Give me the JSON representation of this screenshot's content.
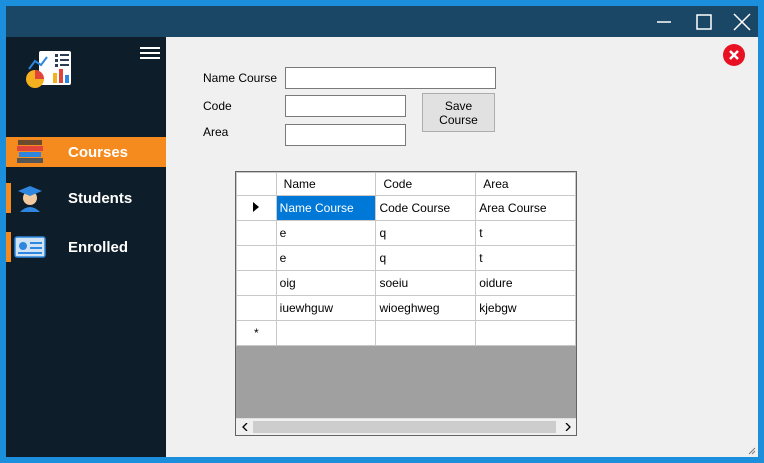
{
  "window": {
    "controls": [
      "minimize-icon",
      "maximize-icon",
      "close-icon"
    ]
  },
  "sidebar": {
    "items": [
      {
        "label": "Courses",
        "icon": "books-icon",
        "active": true
      },
      {
        "label": "Students",
        "icon": "graduate-icon",
        "active": false
      },
      {
        "label": "Enrolled",
        "icon": "id-card-icon",
        "active": false
      }
    ]
  },
  "form": {
    "name_label": "Name Course",
    "code_label": "Code",
    "area_label": "Area",
    "name_value": "",
    "code_value": "",
    "area_value": "",
    "save_label": "Save Course"
  },
  "grid": {
    "headers": [
      "Name",
      "Code",
      "Area"
    ],
    "rows": [
      [
        "Name Course",
        "Code Course",
        "Area Course"
      ],
      [
        "e",
        "q",
        "t"
      ],
      [
        "e",
        "q",
        "t"
      ],
      [
        "oig",
        "soeiu",
        "oidure"
      ],
      [
        "iuewhguw",
        "wioeghweg",
        "kjebgw"
      ]
    ],
    "new_row_marker": "*"
  },
  "colors": {
    "titlebar": "#1b4766",
    "sidebar": "#0d1e2a",
    "accent": "#f58a1f",
    "selection": "#0078d7",
    "close_badge": "#e81123"
  }
}
